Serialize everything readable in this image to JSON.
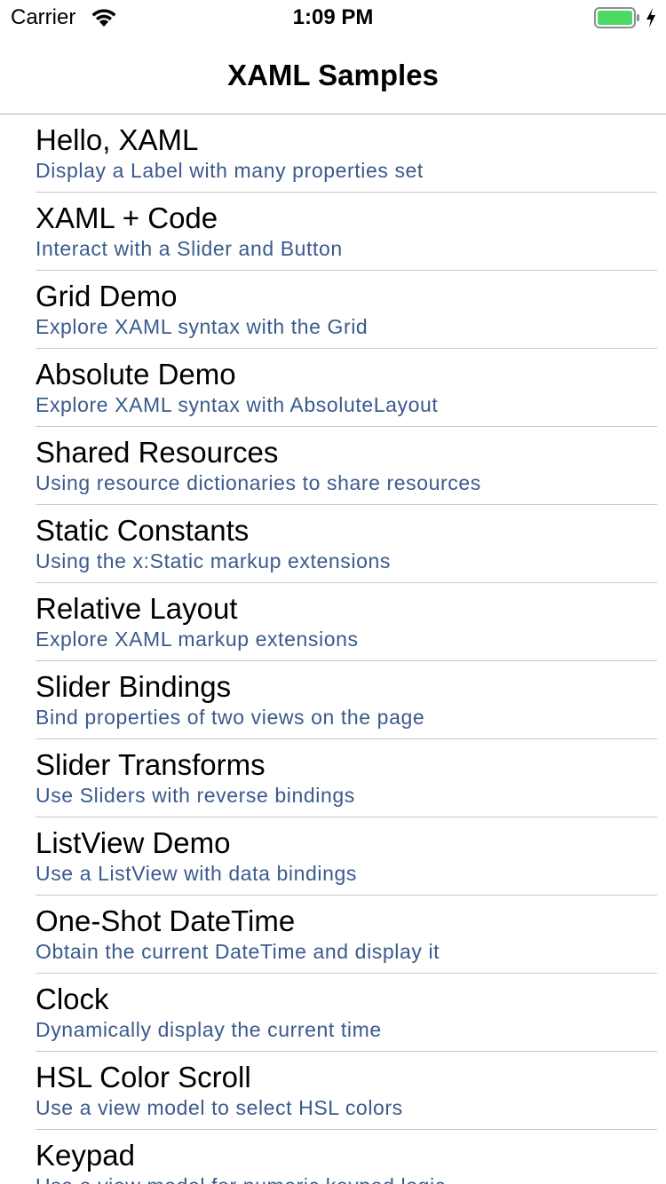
{
  "status_bar": {
    "carrier": "Carrier",
    "time": "1:09 PM",
    "battery_color": "#4cd964"
  },
  "nav": {
    "title": "XAML Samples"
  },
  "colors": {
    "detail_text": "#3a5a8c",
    "separator": "#c8c8cc"
  },
  "items": [
    {
      "title": "Hello, XAML",
      "detail": "Display a Label with many properties set"
    },
    {
      "title": "XAML + Code",
      "detail": "Interact with a Slider and Button"
    },
    {
      "title": "Grid Demo",
      "detail": "Explore XAML syntax with the Grid"
    },
    {
      "title": "Absolute Demo",
      "detail": "Explore XAML syntax with AbsoluteLayout"
    },
    {
      "title": "Shared Resources",
      "detail": "Using resource dictionaries to share resources"
    },
    {
      "title": "Static Constants",
      "detail": "Using the x:Static markup extensions"
    },
    {
      "title": "Relative Layout",
      "detail": "Explore XAML markup extensions"
    },
    {
      "title": "Slider Bindings",
      "detail": "Bind properties of two views on the page"
    },
    {
      "title": "Slider Transforms",
      "detail": "Use Sliders with reverse bindings"
    },
    {
      "title": "ListView Demo",
      "detail": "Use a ListView with data bindings"
    },
    {
      "title": "One-Shot DateTime",
      "detail": "Obtain the current DateTime and display it"
    },
    {
      "title": "Clock",
      "detail": "Dynamically display the current time"
    },
    {
      "title": "HSL Color Scroll",
      "detail": "Use a view model to select HSL colors"
    },
    {
      "title": "Keypad",
      "detail": "Use a view model for numeric keypad logic"
    }
  ]
}
